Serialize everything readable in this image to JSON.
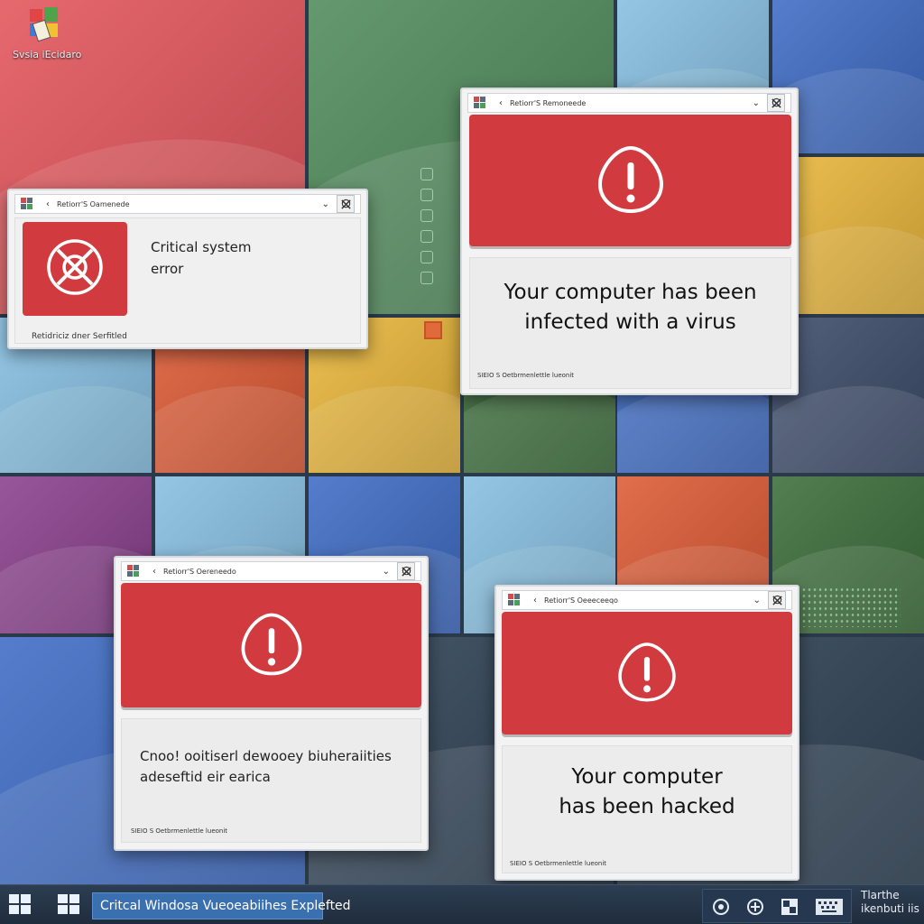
{
  "desktop": {
    "icon_label": "Svsia iEcidaro",
    "tile_colors": {
      "red": "#e2545a",
      "green": "#4f8a5a",
      "light_blue": "#86bfe1",
      "blue": "#3d6bc4",
      "yellow": "#e9b63a",
      "orange": "#dd5a34",
      "purple": "#8a3f8c",
      "navy": "#3b4b69",
      "dark_green": "#3b6d3a",
      "slate": "#2f4255"
    }
  },
  "colors": {
    "alert_red": "#d13b3f",
    "window_bg": "#f3f3f3",
    "taskbar_active": "#3a6fb0"
  },
  "windows": {
    "critical": {
      "title": "Retiorr'S Oamenede",
      "message_line1": "Critical system",
      "message_line2": "error",
      "footer": "Retidriciz dner Serfitled",
      "icon": "x-circle-icon"
    },
    "virus": {
      "title": "Retiorr'S Remoneede",
      "message_line1": "Your computer has been",
      "message_line2": "infected with a virus",
      "footer": "SIEIO S Oetbrmenlettle lueonit",
      "icon": "warning-icon"
    },
    "vulnerabilities": {
      "title": "Retiorr'S Oereneedo",
      "message_line1": "Cnoo! ooitiserl dewooey biuheraiities",
      "message_line2": "adeseftid eir earica",
      "footer": "SIEIO S Oetbrmenlettle lueonit",
      "icon": "warning-icon"
    },
    "hacked": {
      "title": "Retiorr'S Oeeeceeqo",
      "message_line1": "Your computer",
      "message_line2": "has been hacked",
      "footer": "SIEIO S Oetbrmenlettle lueonit",
      "icon": "warning-icon"
    }
  },
  "taskbar": {
    "active_item": "Critcal Windosa Vueoeabiihes Explefted",
    "clock_line1": "Tlarthe",
    "clock_line2": "ikenbuti iis"
  }
}
